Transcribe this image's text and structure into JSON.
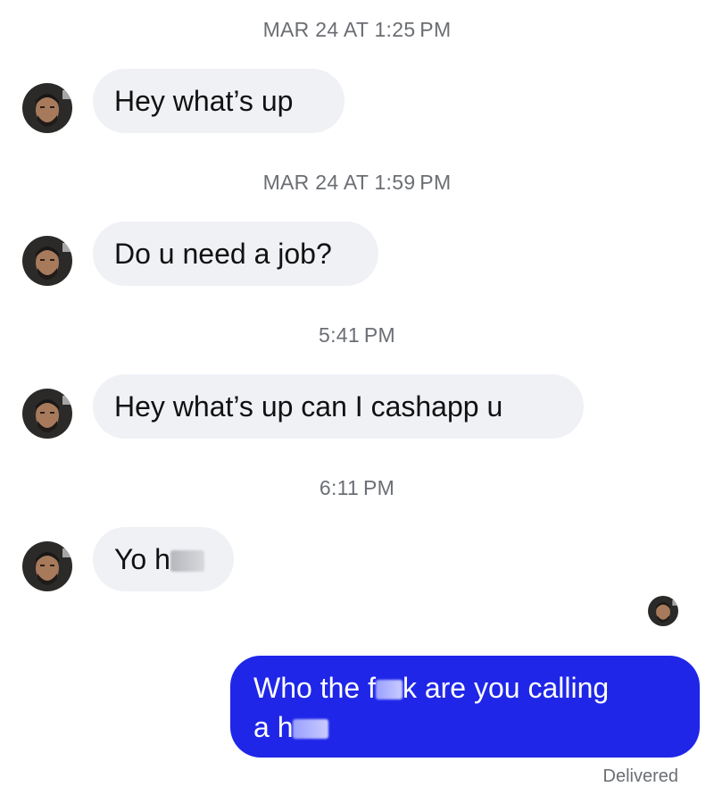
{
  "contact": {
    "avatar_icon": "contact-avatar-icon"
  },
  "messages": [
    {
      "timestamp": "MAR 24 AT 1:25 PM",
      "text": "Hey what’s up",
      "redacted": false
    },
    {
      "timestamp": "MAR 24 AT 1:59 PM",
      "text": "Do u need a job?",
      "redacted": false
    },
    {
      "timestamp": "5:41 PM",
      "text": "Hey what’s up can I cashapp u",
      "redacted": false
    },
    {
      "timestamp": "6:11 PM",
      "text": "Yo h",
      "redacted": true
    }
  ],
  "outgoing": {
    "line1_part1": "Who the f",
    "line1_part2": "k are you calling",
    "line2": "a h",
    "status": "Delivered",
    "read_receipt_icon": "read-receipt-avatar-icon"
  },
  "colors": {
    "incoming_bubble": "#eff1f5",
    "outgoing_bubble": "#1f26e8",
    "timestamp_text": "#6b6e73"
  }
}
